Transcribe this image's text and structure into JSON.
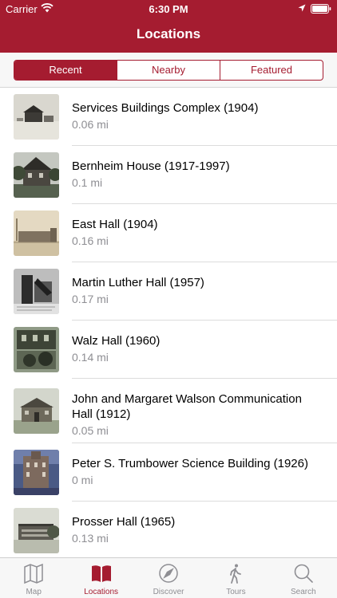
{
  "status_bar": {
    "carrier": "Carrier",
    "time": "6:30 PM"
  },
  "nav": {
    "title": "Locations"
  },
  "segments": [
    "Recent",
    "Nearby",
    "Featured"
  ],
  "segment_selected": "Recent",
  "locations": [
    {
      "title": "Services Buildings Complex (1904)",
      "distance": "0.06 mi"
    },
    {
      "title": "Bernheim House (1917-1997)",
      "distance": "0.1 mi"
    },
    {
      "title": "East Hall (1904)",
      "distance": "0.16 mi"
    },
    {
      "title": "Martin Luther Hall (1957)",
      "distance": "0.17 mi"
    },
    {
      "title": "Walz Hall (1960)",
      "distance": "0.14 mi"
    },
    {
      "title": "John and Margaret Walson Communication Hall (1912)",
      "distance": "0.05 mi"
    },
    {
      "title": "Peter S. Trumbower Science Building (1926)",
      "distance": "0 mi"
    },
    {
      "title": "Prosser Hall (1965)",
      "distance": "0.13 mi"
    }
  ],
  "tabs": [
    {
      "label": "Map",
      "icon": "map-icon"
    },
    {
      "label": "Locations",
      "icon": "book-icon"
    },
    {
      "label": "Discover",
      "icon": "compass-icon"
    },
    {
      "label": "Tours",
      "icon": "walking-person-icon"
    },
    {
      "label": "Search",
      "icon": "search-icon"
    }
  ],
  "tab_selected": "Locations",
  "colors": {
    "accent": "#a51c30",
    "secondary_text": "#8e8e93",
    "inactive_tab": "#8e8e93"
  }
}
